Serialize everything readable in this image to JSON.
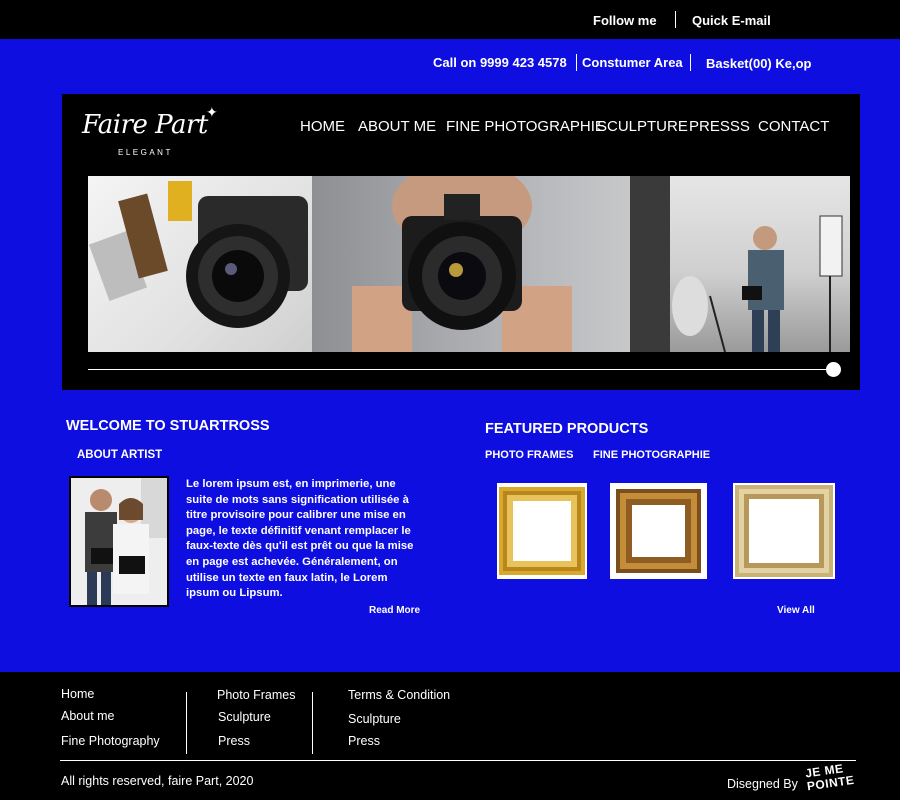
{
  "topbar": {
    "follow_me": "Follow me",
    "quick_email": "Quick E-mail"
  },
  "infobar": {
    "call": "Call on 9999 423 4578",
    "consumer": "Constumer Area",
    "basket": "Basket(00) Ke,op"
  },
  "logo": {
    "name": "Faire Part",
    "tagline": "ELEGANT"
  },
  "nav": [
    "HOME",
    "ABOUT ME",
    "FINE PHOTOGRAPHIE",
    "SCULPTURE",
    "PRESSS",
    "CONTACT"
  ],
  "welcome": {
    "title": "WELCOME TO STUARTROSS",
    "subtitle": "ABOUT ARTIST",
    "body": "Le lorem ipsum est, en imprimerie, une suite de mots sans signification utilisée à titre provisoire pour calibrer une mise en page, le texte définitif venant remplacer le faux-texte dès qu'il est prêt ou que la mise en page est achevée. Généralement, on utilise un texte en faux latin, le Lorem ipsum ou Lipsum.",
    "read_more": "Read More"
  },
  "featured": {
    "title": "FEATURED PRODUCTS",
    "tabs": [
      "PHOTO FRAMES",
      "FINE PHOTOGRAPHIE"
    ],
    "view_all": "View All"
  },
  "footer": {
    "col1": [
      "Home",
      "About me",
      "Fine Photography"
    ],
    "col2": [
      "Photo Frames",
      "Sculpture",
      "Press"
    ],
    "col3": [
      "Terms & Condition",
      "Sculpture",
      "Press"
    ],
    "copyright": "All rights reserved, faire Part, 2020",
    "designed_by": "Disegned By",
    "designer_logo": "JE ME POINTE"
  },
  "colors": {
    "background": "#0e0ee0",
    "dark": "#000000",
    "text": "#ffffff",
    "gold": "#c9a23a"
  }
}
